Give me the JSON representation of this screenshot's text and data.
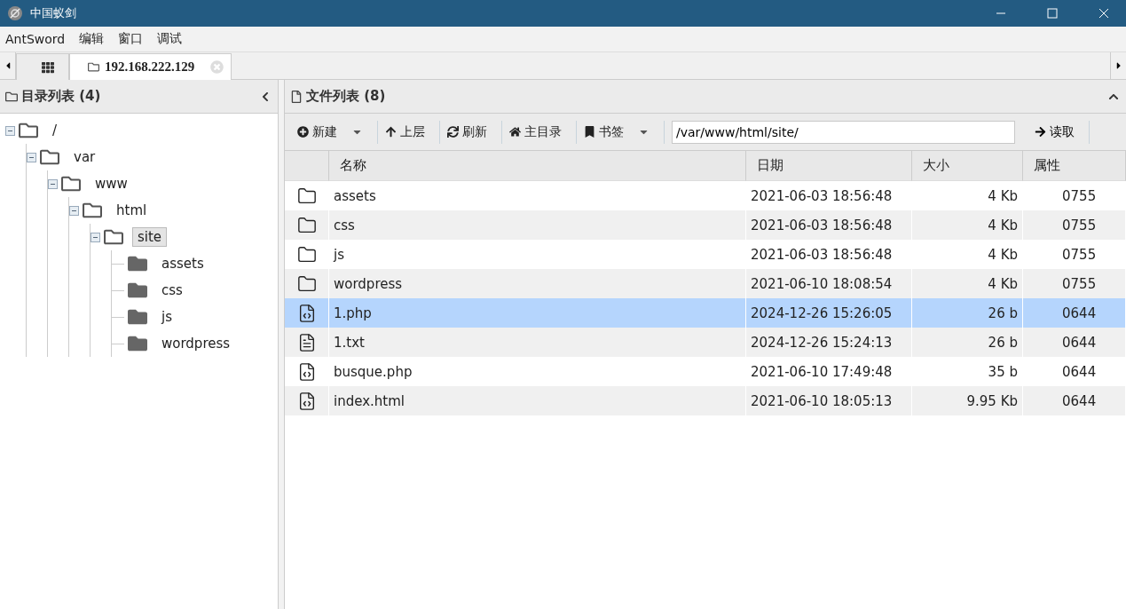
{
  "window": {
    "title": "中国蚁剑"
  },
  "menu": [
    "AntSword",
    "编辑",
    "窗口",
    "调试"
  ],
  "tabs": [
    {
      "kind": "home",
      "selected": false
    },
    {
      "kind": "shell",
      "label": "192.168.222.129",
      "selected": true
    }
  ],
  "tree_panel": {
    "title": "目录列表 (4)",
    "tree": [
      {
        "label": "/",
        "expanded": true,
        "selected": false,
        "children": [
          {
            "label": "var",
            "expanded": true,
            "selected": false,
            "children": [
              {
                "label": "www",
                "expanded": true,
                "selected": false,
                "children": [
                  {
                    "label": "html",
                    "expanded": true,
                    "selected": false,
                    "children": [
                      {
                        "label": "site",
                        "expanded": true,
                        "selected": true,
                        "children": [
                          {
                            "label": "assets",
                            "expanded": false,
                            "selected": false
                          },
                          {
                            "label": "css",
                            "expanded": false,
                            "selected": false
                          },
                          {
                            "label": "js",
                            "expanded": false,
                            "selected": false
                          },
                          {
                            "label": "wordpress",
                            "expanded": false,
                            "selected": false
                          }
                        ]
                      }
                    ]
                  }
                ]
              }
            ]
          }
        ]
      }
    ]
  },
  "file_panel": {
    "title": "文件列表 (8)",
    "toolbar": [
      {
        "kind": "new",
        "label": "新建",
        "has_menu": true
      },
      {
        "kind": "up",
        "label": "上层",
        "has_menu": false
      },
      {
        "kind": "refresh",
        "label": "刷新",
        "has_menu": false
      },
      {
        "kind": "home",
        "label": "主目录",
        "has_menu": false
      },
      {
        "kind": "bookmark",
        "label": "书签",
        "has_menu": true
      }
    ],
    "path": "/var/www/html/site/",
    "read_button": "读取",
    "columns": [
      "名称",
      "日期",
      "大小",
      "属性"
    ],
    "rows": [
      {
        "kind": "folder",
        "name": "assets",
        "date": "2021-06-03 18:56:48",
        "size": "4 Kb",
        "mode": "0755",
        "selected": false
      },
      {
        "kind": "folder",
        "name": "css",
        "date": "2021-06-03 18:56:48",
        "size": "4 Kb",
        "mode": "0755",
        "selected": false
      },
      {
        "kind": "folder",
        "name": "js",
        "date": "2021-06-03 18:56:48",
        "size": "4 Kb",
        "mode": "0755",
        "selected": false
      },
      {
        "kind": "folder",
        "name": "wordpress",
        "date": "2021-06-10 18:08:54",
        "size": "4 Kb",
        "mode": "0755",
        "selected": false
      },
      {
        "kind": "code",
        "name": "1.php",
        "date": "2024-12-26 15:26:05",
        "size": "26 b",
        "mode": "0644",
        "selected": true
      },
      {
        "kind": "text",
        "name": "1.txt",
        "date": "2024-12-26 15:24:13",
        "size": "26 b",
        "mode": "0644",
        "selected": false
      },
      {
        "kind": "code",
        "name": "busque.php",
        "date": "2021-06-10 17:49:48",
        "size": "35 b",
        "mode": "0644",
        "selected": false
      },
      {
        "kind": "code",
        "name": "index.html",
        "date": "2021-06-10 18:05:13",
        "size": "9.95 Kb",
        "mode": "0644",
        "selected": false
      }
    ]
  }
}
